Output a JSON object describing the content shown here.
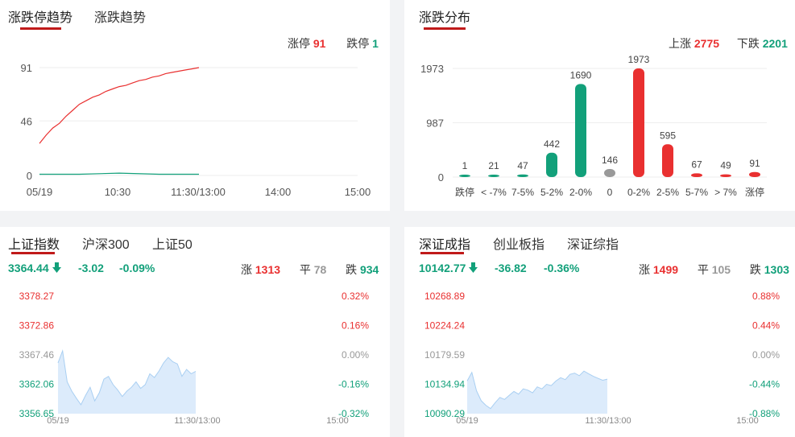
{
  "trend_panel": {
    "tabs": [
      "涨跌停趋势",
      "涨跌趋势"
    ],
    "legend": {
      "up_label": "涨停",
      "up_value": "91",
      "down_label": "跌停",
      "down_value": "1"
    }
  },
  "dist_panel": {
    "tabs": [
      "涨跌分布"
    ],
    "legend": {
      "up_label": "上涨",
      "up_value": "2775",
      "down_label": "下跌",
      "down_value": "2201"
    }
  },
  "sh_panel": {
    "tabs": [
      "上证指数",
      "沪深300",
      "上证50"
    ],
    "price": "3364.44",
    "change": "-3.02",
    "change_pct": "-0.09%",
    "up_label": "涨",
    "up_count": "1313",
    "flat_label": "平",
    "flat_count": "78",
    "down_label": "跌",
    "down_count": "934"
  },
  "sz_panel": {
    "tabs": [
      "深证成指",
      "创业板指",
      "深证综指"
    ],
    "price": "10142.77",
    "change": "-36.82",
    "change_pct": "-0.36%",
    "up_label": "涨",
    "up_count": "1499",
    "flat_label": "平",
    "flat_count": "105",
    "down_label": "跌",
    "down_count": "1303"
  },
  "colors": {
    "up": "#e93030",
    "down": "#12a07a",
    "flat": "#999999",
    "accent": "#c01a1a",
    "area": "#dcebfb",
    "area_line": "#a9cff2"
  },
  "chart_data": [
    {
      "type": "line",
      "title": "涨跌停趋势",
      "x_ticks": [
        "05/19",
        "10:30",
        "11:30/13:00",
        "14:00",
        "15:00"
      ],
      "y_ticks": [
        "0",
        "46",
        "91"
      ],
      "ylim": [
        0,
        91
      ],
      "series": [
        {
          "name": "涨停",
          "color": "#e93030",
          "x": [
            0,
            5,
            10,
            15,
            20,
            25,
            30,
            35,
            40,
            45,
            50,
            55,
            60,
            65,
            70,
            75,
            80,
            85,
            90,
            95,
            100,
            105,
            110,
            115,
            120
          ],
          "y": [
            27,
            34,
            40,
            44,
            50,
            55,
            60,
            63,
            66,
            68,
            71,
            73,
            75,
            76,
            78,
            80,
            81,
            83,
            84,
            86,
            87,
            88,
            89,
            90,
            91
          ]
        },
        {
          "name": "跌停",
          "color": "#12a07a",
          "x": [
            0,
            30,
            60,
            90,
            120
          ],
          "y": [
            1,
            1,
            2,
            1,
            1
          ]
        }
      ]
    },
    {
      "type": "bar",
      "title": "涨跌分布",
      "categories": [
        "跌停",
        "< -7%",
        "7-5%",
        "5-2%",
        "2-0%",
        "0",
        "0-2%",
        "2-5%",
        "5-7%",
        "> 7%",
        "涨停"
      ],
      "values": [
        1,
        21,
        47,
        442,
        1690,
        146,
        1973,
        595,
        67,
        49,
        91
      ],
      "y_ticks": [
        "0",
        "987",
        "1973"
      ],
      "ylim": [
        0,
        1973
      ],
      "colors": [
        "#12a07a",
        "#12a07a",
        "#12a07a",
        "#12a07a",
        "#12a07a",
        "#999999",
        "#e93030",
        "#e93030",
        "#e93030",
        "#e93030",
        "#e93030"
      ]
    },
    {
      "type": "area",
      "title": "上证指数",
      "left_ticks": [
        "3378.27",
        "3372.86",
        "3367.46",
        "3362.06",
        "3356.65"
      ],
      "right_ticks": [
        "0.32%",
        "0.16%",
        "0.00%",
        "-0.16%",
        "-0.32%"
      ],
      "x_ticks": [
        "05/19",
        "11:30/13:00",
        "15:00"
      ],
      "ylim": [
        3356.65,
        3378.27
      ],
      "x": [
        0,
        4,
        8,
        12,
        16,
        20,
        24,
        28,
        32,
        36,
        40,
        44,
        48,
        52,
        56,
        60,
        64,
        68,
        72,
        76,
        80,
        84,
        88,
        92,
        96,
        100,
        104,
        108,
        112,
        116,
        120
      ],
      "y": [
        3366.0,
        3368.2,
        3362.5,
        3360.8,
        3359.5,
        3358.3,
        3360.0,
        3361.5,
        3359.0,
        3360.5,
        3363.0,
        3363.5,
        3362.0,
        3361.0,
        3359.8,
        3360.8,
        3361.5,
        3362.5,
        3361.3,
        3362.0,
        3364.0,
        3363.3,
        3364.5,
        3366.0,
        3367.0,
        3366.2,
        3365.8,
        3363.5,
        3364.8,
        3364.0,
        3364.44
      ]
    },
    {
      "type": "area",
      "title": "深证成指",
      "left_ticks": [
        "10268.89",
        "10224.24",
        "10179.59",
        "10134.94",
        "10090.29"
      ],
      "right_ticks": [
        "0.88%",
        "0.44%",
        "0.00%",
        "-0.44%",
        "-0.88%"
      ],
      "x_ticks": [
        "05/19",
        "11:30/13:00",
        "15:00"
      ],
      "ylim": [
        10090.29,
        10268.89
      ],
      "x": [
        0,
        4,
        8,
        12,
        16,
        20,
        24,
        28,
        32,
        36,
        40,
        44,
        48,
        52,
        56,
        60,
        64,
        68,
        72,
        76,
        80,
        84,
        88,
        92,
        96,
        100,
        104,
        108,
        112,
        116,
        120
      ],
      "y": [
        10140.0,
        10153.0,
        10125.0,
        10110.0,
        10103.0,
        10098.0,
        10107.0,
        10115.0,
        10112.0,
        10118.0,
        10124.0,
        10120.0,
        10128.0,
        10126.0,
        10122.0,
        10131.0,
        10128.0,
        10135.0,
        10133.0,
        10140.0,
        10145.0,
        10142.0,
        10150.0,
        10152.0,
        10148.0,
        10155.0,
        10151.0,
        10147.0,
        10144.0,
        10141.0,
        10142.77
      ]
    }
  ]
}
